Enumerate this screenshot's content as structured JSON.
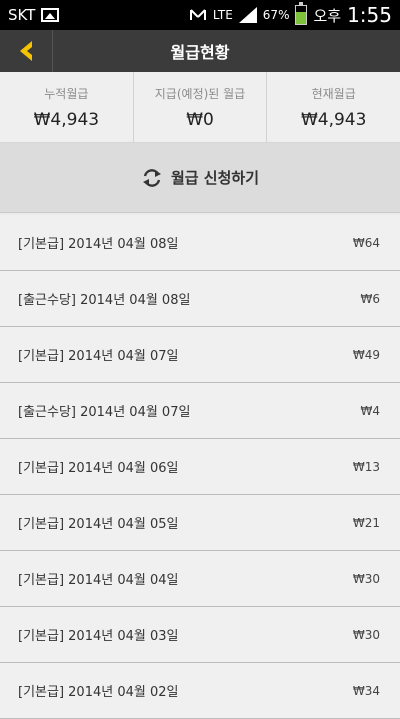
{
  "status": {
    "carrier": "SKT",
    "network": "LTE",
    "battery": "67%",
    "battery_level": 0.67,
    "ampm": "오후",
    "time": "1:55"
  },
  "header": {
    "title": "월급현황",
    "back_icon": "chevron-left-icon"
  },
  "summary": [
    {
      "label": "누적월급",
      "value": "₩4,943"
    },
    {
      "label": "지급(예정)된 월급",
      "value": "₩0"
    },
    {
      "label": "현재월급",
      "value": "₩4,943"
    }
  ],
  "apply": {
    "label": "월급 신청하기",
    "icon": "refresh-icon"
  },
  "entries": [
    {
      "text": "[기본급] 2014년 04월 08일",
      "amount": "₩64"
    },
    {
      "text": "[출근수당] 2014년 04월 08일",
      "amount": "₩6"
    },
    {
      "text": "[기본급] 2014년 04월 07일",
      "amount": "₩49"
    },
    {
      "text": "[출근수당] 2014년 04월 07일",
      "amount": "₩4"
    },
    {
      "text": "[기본급] 2014년 04월 06일",
      "amount": "₩13"
    },
    {
      "text": "[기본급] 2014년 04월 05일",
      "amount": "₩21"
    },
    {
      "text": "[기본급] 2014년 04월 04일",
      "amount": "₩30"
    },
    {
      "text": "[기본급] 2014년 04월 03일",
      "amount": "₩30"
    },
    {
      "text": "[기본급] 2014년 04월 02일",
      "amount": "₩34"
    }
  ],
  "colors": {
    "accent": "#f5c400",
    "titlebar": "#3b3b3b"
  }
}
